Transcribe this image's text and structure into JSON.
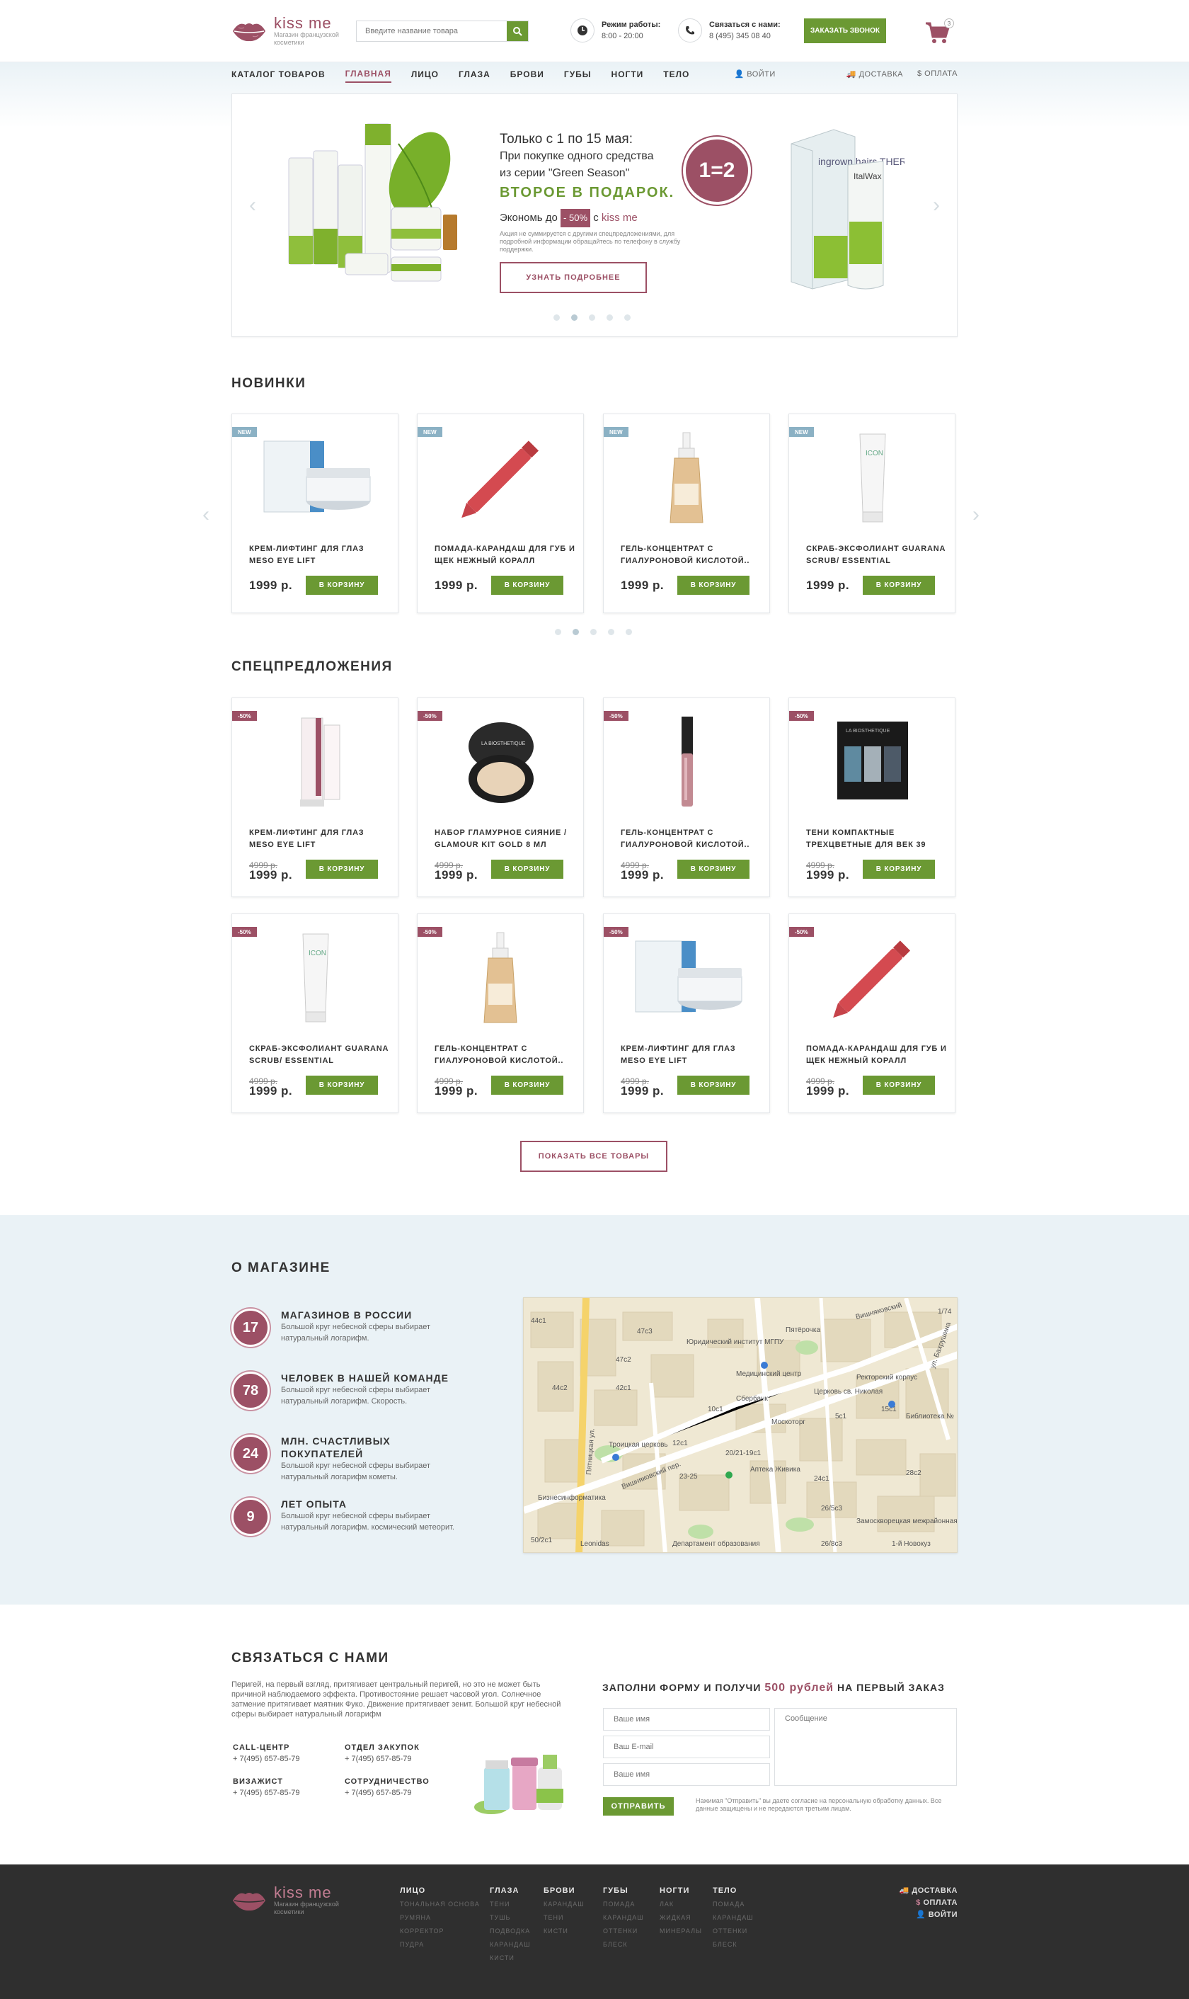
{
  "header": {
    "logo_title": "kiss me",
    "logo_sub": "Магазин французской косметики",
    "search_placeholder": "Введите название товара",
    "hours_label": "Режим работы:",
    "hours_value": "8:00 - 20:00",
    "contact_label": "Связаться с нами:",
    "contact_value": "8 (495) 345 08 40",
    "callback_label": "Заказать звонок",
    "cart_count": "3"
  },
  "nav": {
    "items": [
      "Каталог товаров",
      "Главная",
      "Лицо",
      "Глаза",
      "Брови",
      "Губы",
      "Ногти",
      "Тело"
    ],
    "login": "Войти",
    "delivery": "Доставка",
    "payment": "Оплата"
  },
  "slider": {
    "line1": "Только с 1 по 15 мая:",
    "line2": "При покупке одного средства",
    "line3": "из серии \"Green Season\"",
    "line4": "ВТОРОЕ В ПОДАРОК.",
    "save_prefix": "Экономь до",
    "save_badge": "- 50%",
    "save_suffix": "с",
    "save_brand": "kiss me",
    "note": "Акция не суммируется с другими спецпредложениями, для подробной информации обращайтесь по телефону в службу поддержки.",
    "promo": "1=2",
    "button": "Узнать подробнее",
    "product_brand": "ItalWax",
    "product_name": "ingrown hairs THERAPY"
  },
  "new_section": {
    "title": "Новинки",
    "products": [
      {
        "tag": "NEW",
        "name": "Крем-лифтинг для глаз Meso eye lift",
        "price": "1999 р.",
        "button": "В корзину",
        "image": "jar-icon"
      },
      {
        "tag": "NEW",
        "name": "Помада-карандаш для губ и щек нежный коралл",
        "price": "1999 р.",
        "button": "В корзину",
        "image": "lip-pencil-icon"
      },
      {
        "tag": "NEW",
        "name": "Гель-концентрат с гиалуроновой кислотой..",
        "price": "1999 р.",
        "button": "В корзину",
        "image": "spray-bottle-icon"
      },
      {
        "tag": "NEW",
        "name": "Скраб-эксфолиант guarana scrub/ essential",
        "price": "1999 р.",
        "button": "В корзину",
        "image": "tube-icon"
      }
    ]
  },
  "sale_section": {
    "title": "Спецпредложения",
    "products": [
      {
        "tag": "-50%",
        "name": "Крем-лифтинг для глаз Meso eye lift",
        "old_price": "4999 р.",
        "price": "1999 р.",
        "button": "В корзину",
        "image": "pink-tube-icon"
      },
      {
        "tag": "-50%",
        "name": "Набор гламурное сияние / Glamour kit gold 8 мл",
        "old_price": "4999 р.",
        "price": "1999 р.",
        "button": "В корзину",
        "image": "compact-icon"
      },
      {
        "tag": "-50%",
        "name": "Гель-концентрат с гиалуроновой кислотой..",
        "old_price": "4999 р.",
        "price": "1999 р.",
        "button": "В корзину",
        "image": "gloss-icon"
      },
      {
        "tag": "-50%",
        "name": "Тени компактные трехцветные для век 39",
        "old_price": "4999 р.",
        "price": "1999 р.",
        "button": "В корзину",
        "image": "palette-icon"
      },
      {
        "tag": "-50%",
        "name": "Скраб-эксфолиант guarana scrub/ essential",
        "old_price": "4999 р.",
        "price": "1999 р.",
        "button": "В корзину",
        "image": "tube-icon"
      },
      {
        "tag": "-50%",
        "name": "Гель-концентрат с гиалуроновой кислотой..",
        "old_price": "4999 р.",
        "price": "1999 р.",
        "button": "В корзину",
        "image": "spray-bottle-icon"
      },
      {
        "tag": "-50%",
        "name": "Крем-лифтинг для глаз Meso eye lift",
        "old_price": "4999 р.",
        "price": "1999 р.",
        "button": "В корзину",
        "image": "jar-icon"
      },
      {
        "tag": "-50%",
        "name": "Помада-карандаш для губ и щек нежный коралл",
        "old_price": "4999 р.",
        "price": "1999 р.",
        "button": "В корзину",
        "image": "lip-pencil-icon"
      }
    ],
    "show_all": "Показать все товары"
  },
  "about": {
    "title": "О магазине",
    "stats": [
      {
        "num": "17",
        "title": "Магазинов в России",
        "desc": "Большой круг небесной сферы выбирает натуральный логарифм."
      },
      {
        "num": "78",
        "title": "Человек в нашей команде",
        "desc": "Большой круг небесной сферы выбирает натуральный логарифм. Скорость."
      },
      {
        "num": "24",
        "title": "Млн. счастливых покупателей",
        "desc": "Большой круг небесной сферы выбирает натуральный логарифм кометы."
      },
      {
        "num": "9",
        "title": "Лет опыта",
        "desc": "Большой круг небесной сферы выбирает натуральный логарифм. космический метеорит."
      }
    ],
    "map_labels": [
      "Пятницкая ул.",
      "Вишняковский пер.",
      "Медицинский центр",
      "Сбербанк",
      "Аптека Живика",
      "Москоторг",
      "Церковь св. Николая",
      "Библиотека №",
      "Юридический институт МГПУ",
      "Ректорский корпус",
      "Пятёрочка",
      "Троицкая церковь",
      "Замоскворецкая межрайонная прокурат.",
      "Департамент образования",
      "Leonidas",
      "Бизнесинформатика",
      "1-й Новокуз",
      "ул. Бахрушина",
      "Вишняковский",
      "44с1",
      "44с2",
      "42с1",
      "47с3",
      "47с2",
      "10с1",
      "15с1",
      "5с1",
      "12с1",
      "23-25",
      "20/21-19с1",
      "24с1",
      "28с2",
      "26/5с3",
      "26/8с3",
      "50/2с1",
      "1/74"
    ]
  },
  "contact": {
    "title": "Связаться с нами",
    "desc": "Перигей, на первый взгляд, притягивает центральный перигей, но это не может быть причиной наблюдаемого эффекта. Противостояние решает часовой угол. Солнечное затмение притягивает маятник Фуко. Движение притягивает зенит. Большой круг небесной сферы выбирает натуральный логарифм",
    "groups": [
      {
        "label": "Call-центр",
        "value": "+ 7(495) 657-85-79"
      },
      {
        "label": "Отдел закупок",
        "value": "+ 7(495) 657-85-79"
      },
      {
        "label": "Визажист",
        "value": "+ 7(495) 657-85-79"
      },
      {
        "label": "Сотрудничество",
        "value": "+ 7(495) 657-85-79"
      }
    ],
    "form_title_prefix": "ЗАПОЛНИ ФОРМУ И ПОЛУЧИ",
    "form_title_highlight": "500 рублей",
    "form_title_suffix": "НА ПЕРВЫЙ ЗАКАЗ",
    "name_placeholder": "Ваше имя",
    "email_placeholder": "Ваш E-mail",
    "name2_placeholder": "Ваше имя",
    "message_placeholder": "Сообщение",
    "send_label": "Отправить",
    "note": "Нажимая \"Отправить\" вы даете согласие на персональную обработку данных. Все данные защищены и не передаются третьим лицам."
  },
  "footer": {
    "logo_title": "kiss me",
    "logo_sub": "Магазин французской косметики",
    "columns": [
      {
        "head": "Лицо",
        "items": [
          "Тональная основа",
          "Румяна",
          "Корректор",
          "Пудра"
        ]
      },
      {
        "head": "Глаза",
        "items": [
          "Тени",
          "Тушь",
          "Подводка",
          "Карандаш",
          "Кисти"
        ]
      },
      {
        "head": "Брови",
        "items": [
          "Карандаш",
          "Тени",
          "Кисти"
        ]
      },
      {
        "head": "Губы",
        "items": [
          "Помада",
          "Карандаш",
          "Оттенки",
          "Блеск"
        ]
      },
      {
        "head": "Ногти",
        "items": [
          "Лак",
          "Жидкая",
          "Минералы"
        ]
      },
      {
        "head": "Тело",
        "items": [
          "Помада",
          "Карандаш",
          "Оттенки",
          "Блеск"
        ]
      }
    ],
    "links": [
      "Доставка",
      "Оплата",
      "Войти"
    ]
  },
  "colors": {
    "brand": "#9c5065",
    "green": "#6b9933",
    "new_tag": "#8bb1c4",
    "footer": "#2f2f2f",
    "about_bg": "#eaf2f6"
  }
}
